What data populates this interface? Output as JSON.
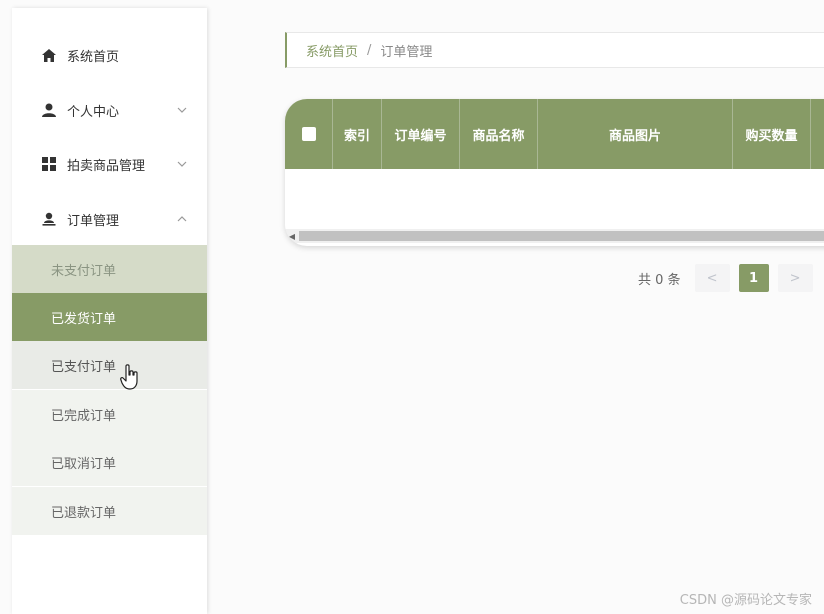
{
  "sidebar": {
    "items": [
      {
        "label": "系统首页",
        "icon": "home-icon"
      },
      {
        "label": "个人中心",
        "icon": "user-icon"
      },
      {
        "label": "拍卖商品管理",
        "icon": "grid-icon"
      },
      {
        "label": "订单管理",
        "icon": "order-user-icon"
      }
    ],
    "order_subitems": [
      {
        "label": "未支付订单",
        "state": "disabled"
      },
      {
        "label": "已发货订单",
        "state": "active"
      },
      {
        "label": "已支付订单",
        "state": "hover"
      },
      {
        "label": "已完成订单",
        "state": "normal"
      },
      {
        "label": "已取消订单",
        "state": "normal"
      },
      {
        "label": "已退款订单",
        "state": "normal"
      }
    ]
  },
  "breadcrumb": {
    "home": "系统首页",
    "separator": "/",
    "current": "订单管理"
  },
  "table": {
    "columns": [
      "索引",
      "订单编号",
      "商品名称",
      "商品图片",
      "购买数量"
    ]
  },
  "pagination": {
    "total": "共 0 条",
    "prev": "<",
    "page": "1",
    "next": ">"
  },
  "watermark": "CSDN @源码论文专家",
  "colors": {
    "accent": "#879b66",
    "accent_light": "#d5dbc8",
    "submenu_bg": "#f1f3ef"
  }
}
